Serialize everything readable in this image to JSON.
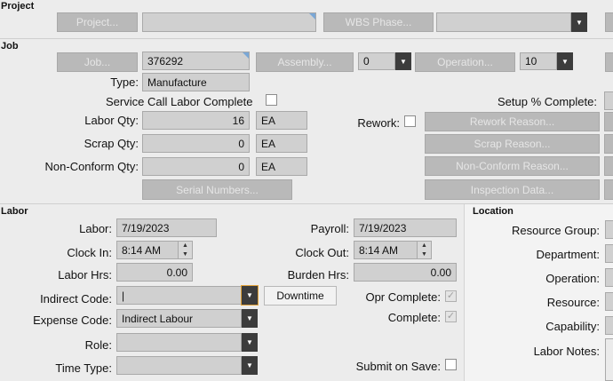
{
  "project": {
    "section_title": "Project",
    "project_button": "Project...",
    "project_value": "",
    "wbs_phase_button": "WBS Phase...",
    "wbs_phase_value": ""
  },
  "job": {
    "section_title": "Job",
    "job_button": "Job...",
    "job_value": "376292",
    "assembly_button": "Assembly...",
    "assembly_value": "0",
    "operation_button": "Operation...",
    "operation_value": "10",
    "type_label": "Type:",
    "type_value": "Manufacture",
    "service_call_label": "Service Call Labor Complete",
    "setup_complete_label": "Setup % Complete:",
    "labor_qty_label": "Labor Qty:",
    "labor_qty_value": "16",
    "labor_qty_uom": "EA",
    "scrap_qty_label": "Scrap Qty:",
    "scrap_qty_value": "0",
    "scrap_qty_uom": "EA",
    "nonconform_qty_label": "Non-Conform Qty:",
    "nonconform_qty_value": "0",
    "nonconform_qty_uom": "EA",
    "rework_label": "Rework:",
    "rework_reason_button": "Rework Reason...",
    "scrap_reason_button": "Scrap Reason...",
    "nonconform_reason_button": "Non-Conform Reason...",
    "serial_numbers_button": "Serial Numbers...",
    "inspection_data_button": "Inspection Data..."
  },
  "labor": {
    "section_title": "Labor",
    "labor_label": "Labor:",
    "labor_date": "7/19/2023",
    "payroll_label": "Payroll:",
    "payroll_date": "7/19/2023",
    "clock_in_label": "Clock In:",
    "clock_in_value": "8:14 AM",
    "clock_out_label": "Clock Out:",
    "clock_out_value": "8:14 AM",
    "labor_hrs_label": "Labor Hrs:",
    "labor_hrs_value": "0.00",
    "burden_hrs_label": "Burden Hrs:",
    "burden_hrs_value": "0.00",
    "indirect_code_label": "Indirect Code:",
    "indirect_code_value": "|",
    "downtime_button": "Downtime",
    "opr_complete_label": "Opr Complete:",
    "expense_code_label": "Expense Code:",
    "expense_code_value": "Indirect Labour",
    "complete_label": "Complete:",
    "role_label": "Role:",
    "role_value": "",
    "time_type_label": "Time Type:",
    "time_type_value": "",
    "submit_on_save_label": "Submit on Save:"
  },
  "location": {
    "section_title": "Location",
    "resource_group_label": "Resource Group:",
    "department_label": "Department:",
    "operation_label": "Operation:",
    "resource_label": "Resource:",
    "capability_label": "Capability:",
    "labor_notes_label": "Labor Notes:"
  }
}
